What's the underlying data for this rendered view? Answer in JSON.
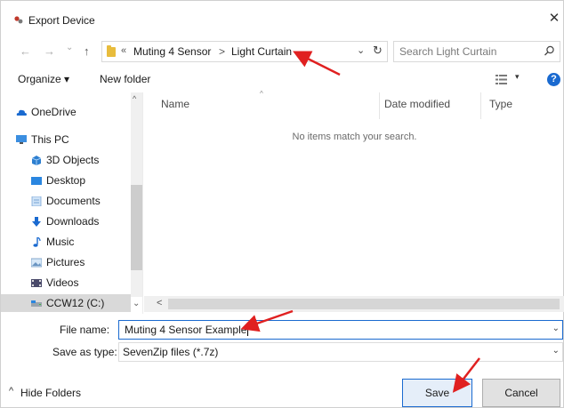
{
  "window": {
    "title": "Export Device",
    "close_glyph": "✕"
  },
  "address": {
    "back_glyph": "←",
    "forward_glyph": "→",
    "history_glyph": "⌄",
    "up_glyph": "↑",
    "overflow_glyph": "«",
    "crumbs": [
      "Muting 4 Sensor",
      "Light Curtain"
    ],
    "crumb_separator": ">",
    "dropdown_glyph": "⌄",
    "refresh_glyph": "↻"
  },
  "search": {
    "placeholder": "Search Light Curtain"
  },
  "toolbar": {
    "organize_label": "Organize ▾",
    "new_folder_label": "New folder",
    "view_dropdown_glyph": "▾",
    "help_glyph": "?"
  },
  "sidebar": {
    "items": [
      {
        "label": "OneDrive",
        "icon": "cloud-icon"
      },
      {
        "label": "This PC",
        "icon": "computer-icon"
      },
      {
        "label": "3D Objects",
        "icon": "cube-icon"
      },
      {
        "label": "Desktop",
        "icon": "desktop-icon"
      },
      {
        "label": "Documents",
        "icon": "document-icon"
      },
      {
        "label": "Downloads",
        "icon": "download-icon"
      },
      {
        "label": "Music",
        "icon": "music-icon"
      },
      {
        "label": "Pictures",
        "icon": "pictures-icon"
      },
      {
        "label": "Videos",
        "icon": "video-icon"
      },
      {
        "label": "CCW12 (C:)",
        "icon": "drive-icon",
        "selected": true
      }
    ],
    "scroll_up_glyph": "^",
    "scroll_down_glyph": "⌄"
  },
  "columns": {
    "name": "Name",
    "date_modified": "Date modified",
    "type": "Type"
  },
  "content": {
    "empty_message": "No items match your search.",
    "hscroll_left_glyph": "<"
  },
  "file_name": {
    "label": "File name:",
    "value": "Muting 4 Sensor Example"
  },
  "save_as_type": {
    "label": "Save as type:",
    "value": "SevenZip files (*.7z)"
  },
  "footer": {
    "hide_folders_label": "Hide Folders",
    "hide_caret_glyph": "^",
    "save_label": "Save",
    "cancel_label": "Cancel"
  },
  "colors": {
    "accent": "#1a6ad0",
    "annotation_arrow": "#e02020",
    "selected_bg": "#d9d9d9"
  }
}
